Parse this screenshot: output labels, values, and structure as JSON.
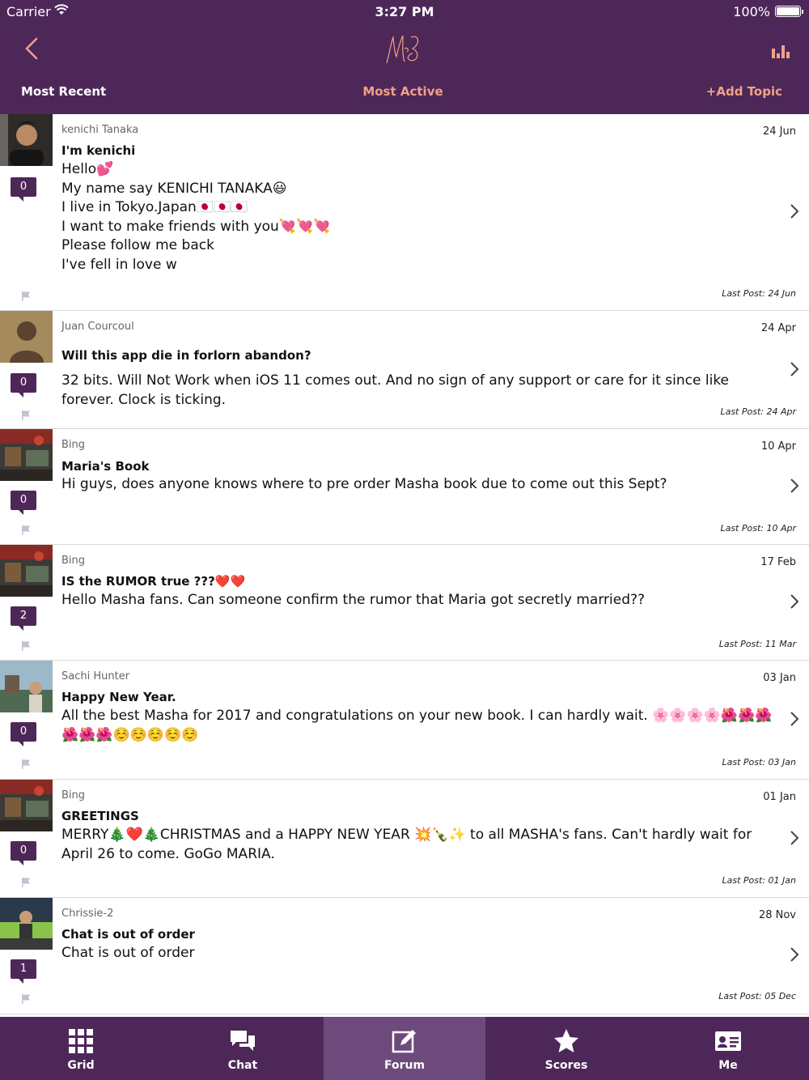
{
  "status": {
    "carrier": "Carrier",
    "time": "3:27 PM",
    "battery": "100%"
  },
  "header": {
    "tabs": {
      "recent": "Most Recent",
      "active": "Most Active",
      "add": "+Add Topic"
    }
  },
  "topics": [
    {
      "author": "kenichi Tanaka",
      "date": "24 Jun",
      "title": "I'm  kenichi",
      "body": "Hello💕\nMy name say KENICHI TANAKA😃\nI live in Tokyo.Japan🇯🇵🇯🇵🇯🇵\nI want to make friends with you💘💘💘\nPlease follow me back\nI've fell in love w",
      "count": "0",
      "last_post": "Last Post: 24 Jun"
    },
    {
      "author": "Juan Courcoul",
      "date": "24 Apr",
      "title": "Will this app die in forlorn abandon?",
      "body": "32 bits. Will Not Work when iOS 11 comes out. And no sign of any support or care for it since like forever. Clock is ticking.",
      "count": "0",
      "last_post": "Last Post: 24 Apr"
    },
    {
      "author": "Bing",
      "date": "10 Apr",
      "title": "Maria's Book",
      "body": "Hi guys, does anyone knows where to pre order Masha book due to come out this Sept?",
      "count": "0",
      "last_post": "Last Post: 10 Apr"
    },
    {
      "author": "Bing",
      "date": "17 Feb",
      "title": "IS the RUMOR true ???❤️❤️",
      "body": "Hello Masha fans. Can someone confirm the rumor that Maria got secretly married??",
      "count": "2",
      "last_post": "Last Post: 11 Mar"
    },
    {
      "author": "Sachi Hunter",
      "date": "03 Jan",
      "title": "Happy New Year.",
      "body": "All the best Masha for  2017 and congratulations on your new book. I can hardly wait. 🌸🌸🌸🌸🌺🌺🌺🌺🌺🌺☺️☺️☺️☺️☺️",
      "count": "0",
      "last_post": "Last Post: 03 Jan"
    },
    {
      "author": "Bing",
      "date": "01 Jan",
      "title": "GREETINGS",
      "body": "MERRY🎄❤️🎄CHRISTMAS and  a HAPPY NEW YEAR 💥🍾✨ to all MASHA's fans. Can't hardly wait for April 26 to come. GoGo MARIA.",
      "count": "0",
      "last_post": "Last Post: 01 Jan"
    },
    {
      "author": "Chrissie-2",
      "date": "28 Nov",
      "title": "Chat is out of order",
      "body": "Chat is out of order",
      "count": "1",
      "last_post": "Last Post: 05 Dec"
    }
  ],
  "tabbar": {
    "grid": "Grid",
    "chat": "Chat",
    "forum": "Forum",
    "scores": "Scores",
    "me": "Me"
  },
  "colors": {
    "header_bg": "#4e2759",
    "accent": "#f0a286",
    "selected_tab": "#6d4a7c"
  }
}
